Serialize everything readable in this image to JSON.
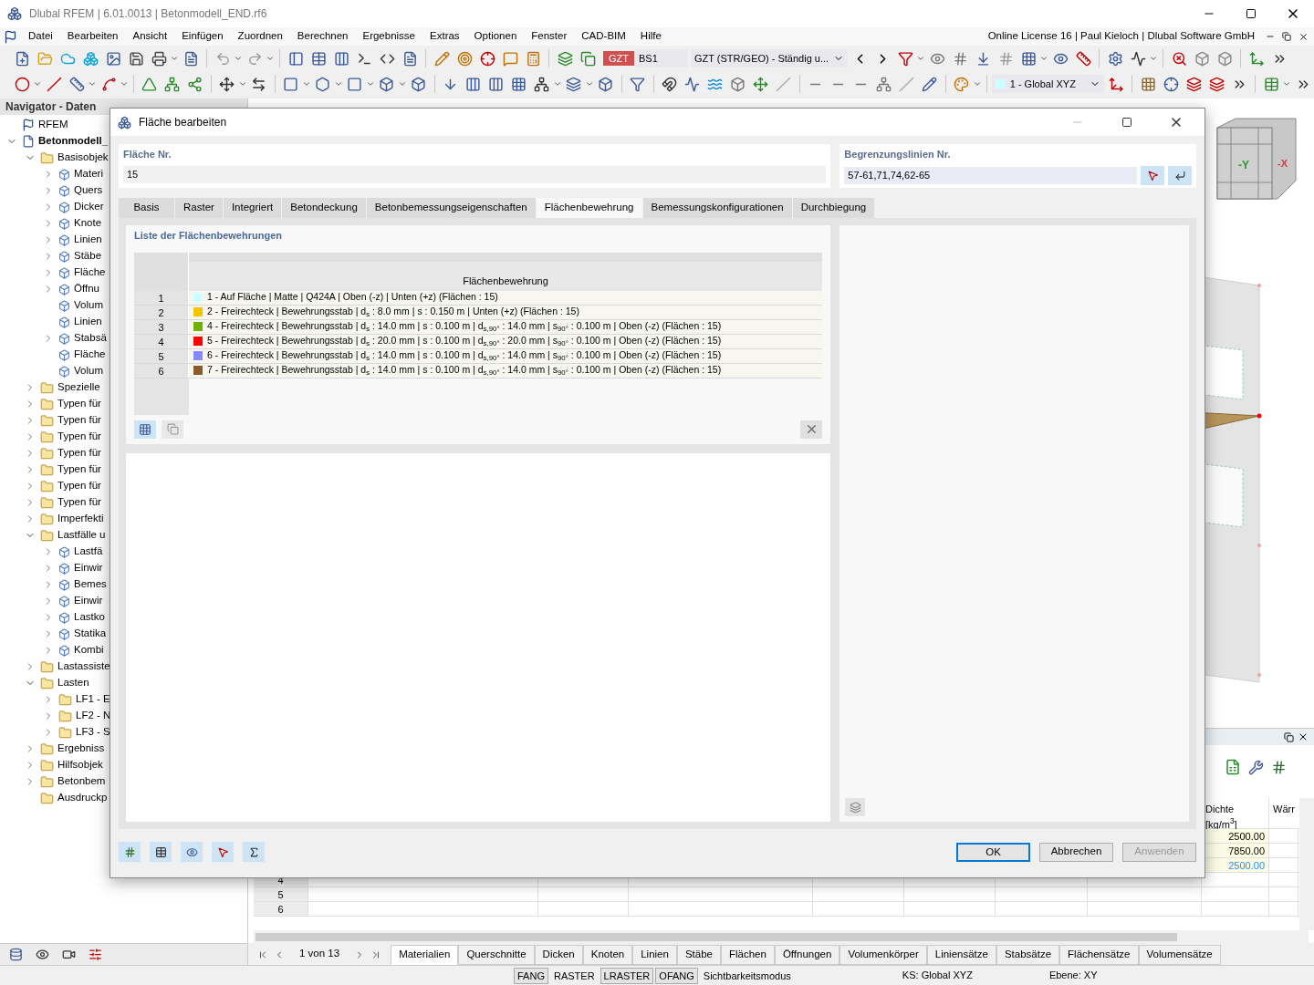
{
  "window": {
    "title": "Dlubal RFEM | 6.01.0013 | Betonmodell_END.rf6"
  },
  "menu": [
    "Datei",
    "Bearbeiten",
    "Ansicht",
    "Einfügen",
    "Zuordnen",
    "Berechnen",
    "Ergebnisse",
    "Extras",
    "Optionen",
    "Fenster",
    "CAD-BIM",
    "Hilfe"
  ],
  "license": "Online License 16 | Paul Kieloch | Dlubal Software GmbH",
  "toolbar": {
    "badge": "GZT",
    "load_case": "BS1",
    "combination": "GZT (STR/GEO) - Ständig u...",
    "coordinate_system": "1 - Global XYZ"
  },
  "navigator": {
    "title": "Navigator - Daten",
    "tree": [
      {
        "label": "RFEM",
        "kind": "app"
      },
      {
        "label": "Betonmodell_",
        "kind": "model",
        "expanded": true,
        "children": [
          {
            "label": "Basisobjek",
            "kind": "folder",
            "expanded": true,
            "children": [
              {
                "label": "Materi",
                "kind": "object",
                "expanded": false
              },
              {
                "label": "Quers",
                "kind": "object",
                "expanded": false
              },
              {
                "label": "Dicker",
                "kind": "object",
                "expanded": false
              },
              {
                "label": "Knote",
                "kind": "object",
                "expanded": false
              },
              {
                "label": "Linien",
                "kind": "object",
                "expanded": false
              },
              {
                "label": "Stäbe",
                "kind": "object",
                "expanded": false
              },
              {
                "label": "Fläche",
                "kind": "object",
                "expanded": false
              },
              {
                "label": "Öffnu",
                "kind": "object",
                "expanded": false
              },
              {
                "label": "Volum",
                "kind": "object"
              },
              {
                "label": "Linien",
                "kind": "object"
              },
              {
                "label": "Stabsä",
                "kind": "object",
                "expanded": false
              },
              {
                "label": "Fläche",
                "kind": "object"
              },
              {
                "label": "Volum",
                "kind": "object"
              }
            ]
          },
          {
            "label": "Spezielle",
            "kind": "folder",
            "expanded": false
          },
          {
            "label": "Typen für",
            "kind": "folder",
            "expanded": false
          },
          {
            "label": "Typen für",
            "kind": "folder",
            "expanded": false
          },
          {
            "label": "Typen für",
            "kind": "folder",
            "expanded": false
          },
          {
            "label": "Typen für",
            "kind": "folder",
            "expanded": false
          },
          {
            "label": "Typen für",
            "kind": "folder",
            "expanded": false
          },
          {
            "label": "Typen für",
            "kind": "folder",
            "expanded": false
          },
          {
            "label": "Typen für",
            "kind": "folder",
            "expanded": false
          },
          {
            "label": "Imperfekti",
            "kind": "folder",
            "expanded": false
          },
          {
            "label": "Lastfälle u",
            "kind": "folder",
            "expanded": true,
            "children": [
              {
                "label": "Lastfä",
                "kind": "object",
                "expanded": false
              },
              {
                "label": "Einwir",
                "kind": "object",
                "expanded": false
              },
              {
                "label": "Bemes",
                "kind": "object",
                "expanded": false
              },
              {
                "label": "Einwir",
                "kind": "object",
                "expanded": false
              },
              {
                "label": "Lastko",
                "kind": "object",
                "expanded": false
              },
              {
                "label": "Statika",
                "kind": "object",
                "expanded": false
              },
              {
                "label": "Kombi",
                "kind": "object",
                "expanded": false
              }
            ]
          },
          {
            "label": "Lastassiste",
            "kind": "folder",
            "expanded": false
          },
          {
            "label": "Lasten",
            "kind": "folder",
            "expanded": true,
            "children": [
              {
                "label": "LF1 - E",
                "kind": "folder",
                "expanded": false
              },
              {
                "label": "LF2 - N",
                "kind": "folder",
                "expanded": false
              },
              {
                "label": "LF3 - S",
                "kind": "folder",
                "expanded": false
              }
            ]
          },
          {
            "label": "Ergebniss",
            "kind": "folder",
            "expanded": false
          },
          {
            "label": "Hilfsobjek",
            "kind": "folder",
            "expanded": false
          },
          {
            "label": "Betonbem",
            "kind": "folder",
            "expanded": false
          },
          {
            "label": "Ausdruckp",
            "kind": "folder"
          }
        ]
      }
    ]
  },
  "view_cube": {
    "labels": [
      "-Y",
      "-X"
    ]
  },
  "table_panel": {
    "columns": [
      {
        "label": "Dichte",
        "unit": "[kg/m$^{3}$]"
      },
      {
        "label": "Wärr"
      }
    ],
    "rows": [
      {
        "density": "2500.00"
      },
      {
        "density": "7850.00"
      },
      {
        "density": "2500.00",
        "color": "#1e90ff"
      },
      {
        "number": "4"
      },
      {
        "number": "5"
      },
      {
        "number": "6"
      }
    ]
  },
  "pager": "1 von 13",
  "bottom_tabs": [
    {
      "label": "Materialien",
      "selected": true
    },
    {
      "label": "Querschnitte",
      "selected": false
    },
    {
      "label": "Dicken",
      "selected": false
    },
    {
      "label": "Knoten",
      "selected": false
    },
    {
      "label": "Linien",
      "selected": false
    },
    {
      "label": "Stäbe",
      "selected": false
    },
    {
      "label": "Flächen",
      "selected": false
    },
    {
      "label": "Öffnungen",
      "selected": false
    },
    {
      "label": "Volumenkörper",
      "selected": false
    },
    {
      "label": "Liniensätze",
      "selected": false
    },
    {
      "label": "Stabsätze",
      "selected": false
    },
    {
      "label": "Flächensätze",
      "selected": false
    },
    {
      "label": "Volumensätze",
      "selected": false
    }
  ],
  "status_bar": {
    "toggles": [
      {
        "label": "FANG",
        "on": true
      },
      {
        "label": "RASTER",
        "on": false
      },
      {
        "label": "LRASTER",
        "on": true
      },
      {
        "label": "OFANG",
        "on": true
      },
      {
        "label": "Sichtbarkeitsmodus",
        "on": false
      }
    ],
    "coordinate_system": "KS: Global XYZ",
    "plane": "Ebene: XY"
  },
  "dialog": {
    "title": "Fläche bearbeiten",
    "surface_no": {
      "label": "Fläche Nr.",
      "value": "15"
    },
    "boundary_lines": {
      "label": "Begrenzungslinien Nr.",
      "value": "57-61,71,74,62-65"
    },
    "tabs": [
      {
        "label": "Basis",
        "selected": false
      },
      {
        "label": "Raster",
        "selected": false
      },
      {
        "label": "Integriert",
        "selected": false
      },
      {
        "label": "Betondeckung",
        "selected": false
      },
      {
        "label": "Betonbemessungseigenschaften",
        "selected": false
      },
      {
        "label": "Flächenbewehrung",
        "selected": true
      },
      {
        "label": "Bemessungskonfigurationen",
        "selected": false
      },
      {
        "label": "Durchbiegung",
        "selected": false
      }
    ],
    "list": {
      "title": "Liste der Flächenbewehrungen",
      "column": "Flächenbewehrung",
      "rows": [
        {
          "number": "1",
          "color": "#ccffff",
          "text": "1 - Auf Fläche | Matte | Q424A | Oben (-z) | Unten (+z) (Flächen : 15)"
        },
        {
          "number": "2",
          "color": "#f5c400",
          "text": "2 - Freirechteck | Bewehrungsstab | d$_{s}$ : 8.0 mm | s : 0.150 m | Unten (+z) (Flächen : 15)"
        },
        {
          "number": "3",
          "color": "#6db300",
          "text": "4 - Freirechteck | Bewehrungsstab | d$_{s}$ : 14.0 mm | s : 0.100 m | d$_{s,90°}$ : 14.0 mm | s$_{90°}$ : 0.100 m | Oben (-z) (Flächen : 15)"
        },
        {
          "number": "4",
          "color": "#ff0000",
          "text": "5 - Freirechteck | Bewehrungsstab | d$_{s}$ : 20.0 mm | s : 0.100 m | d$_{s,90°}$ : 20.0 mm | s$_{90°}$ : 0.100 m | Oben (-z) (Flächen : 15)"
        },
        {
          "number": "5",
          "color": "#8888ff",
          "text": "6 - Freirechteck | Bewehrungsstab | d$_{s}$ : 14.0 mm | s : 0.100 m | d$_{s,90°}$ : 14.0 mm | s$_{90°}$ : 0.100 m | Oben (-z) (Flächen : 15)"
        },
        {
          "number": "6",
          "color": "#8b5a2b",
          "text": "7 - Freirechteck | Bewehrungsstab | d$_{s}$ : 14.0 mm | s : 0.100 m | d$_{s,90°}$ : 14.0 mm | s$_{90°}$ : 0.100 m | Oben (-z) (Flächen : 15)"
        }
      ]
    },
    "buttons": [
      {
        "label": "OK",
        "kind": "default",
        "disabled": false
      },
      {
        "label": "Abbrechen",
        "kind": "normal",
        "disabled": false
      },
      {
        "label": "Anwenden",
        "kind": "normal",
        "disabled": true
      }
    ]
  }
}
